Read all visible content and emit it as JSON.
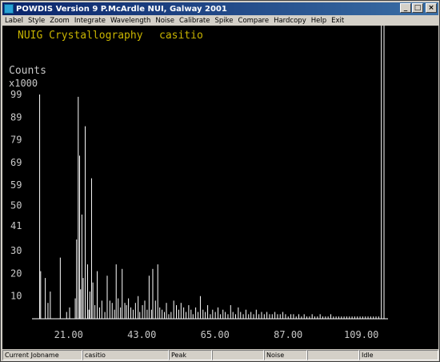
{
  "window": {
    "title": "POWDIS Version 9 P.McArdle NUI, Galway 2001",
    "buttons": {
      "minimize": "_",
      "maximize": "□",
      "close": "×"
    }
  },
  "menu": [
    "Label",
    "Style",
    "Zoom",
    "Integrate",
    "Wavelength",
    "Noise",
    "Calibrate",
    "Spike",
    "Compare",
    "Hardcopy",
    "Help",
    "Exit"
  ],
  "plot": {
    "header_lab": "NUIG Crystallography",
    "header_sample": "casitio",
    "y_label_1": "Counts",
    "y_label_2": "x1000",
    "colors": {
      "background": "#000000",
      "text": "#c8b400",
      "axis": "#ffffff",
      "data": "#ffffff"
    }
  },
  "chart_data": {
    "type": "bar",
    "title": "",
    "xlabel": "",
    "ylabel": "Counts x1000",
    "xlim": [
      10,
      117
    ],
    "ylim": [
      0,
      99
    ],
    "x_ticks": [
      "21.00",
      "43.00",
      "65.00",
      "87.00",
      "109.00"
    ],
    "y_ticks": [
      "10",
      "20",
      "30",
      "41",
      "50",
      "59",
      "69",
      "79",
      "89",
      "99"
    ],
    "x": [
      12.3,
      12.6,
      14.0,
      14.8,
      15.5,
      18.5,
      20.4,
      21.3,
      23.0,
      23.4,
      23.9,
      24.3,
      24.6,
      25.0,
      25.4,
      26.0,
      26.7,
      27.1,
      27.4,
      27.9,
      28.3,
      28.9,
      29.6,
      30.3,
      31.0,
      31.9,
      32.6,
      33.4,
      34.1,
      34.8,
      35.3,
      35.9,
      36.6,
      37.1,
      37.9,
      38.4,
      39.0,
      39.7,
      40.4,
      41.1,
      41.9,
      42.4,
      43.2,
      43.9,
      44.6,
      45.2,
      45.9,
      46.3,
      47.1,
      47.8,
      48.4,
      49.1,
      49.8,
      50.4,
      51.1,
      51.8,
      52.6,
      53.4,
      54.1,
      54.8,
      55.6,
      56.3,
      57.1,
      57.8,
      58.4,
      59.2,
      59.9,
      60.6,
      61.4,
      62.1,
      62.8,
      63.6,
      64.3,
      65.1,
      65.9,
      66.6,
      67.4,
      68.1,
      68.9,
      69.7,
      70.4,
      71.2,
      72.0,
      72.7,
      73.5,
      74.3,
      75.1,
      75.8,
      76.6,
      77.4,
      78.2,
      79.0,
      79.8,
      80.6,
      81.4,
      82.2,
      83.0,
      83.8,
      84.6,
      85.4,
      86.2,
      87.0,
      87.8,
      88.6,
      89.4,
      90.2,
      91.0,
      91.8,
      92.6,
      93.4,
      94.2,
      95.0,
      95.8,
      96.6,
      97.4,
      98.2,
      99.0,
      99.8,
      100.6,
      101.4,
      102.2,
      103.0,
      103.8,
      104.6,
      105.4,
      106.2,
      107.0,
      107.8,
      108.6,
      109.4,
      110.2,
      111.0,
      111.8,
      112.6,
      113.4,
      114.2,
      115.0,
      115.8
    ],
    "values": [
      99,
      21,
      18,
      7,
      12,
      27,
      3,
      5,
      9,
      35,
      98,
      72,
      13,
      46,
      18,
      85,
      24,
      4,
      12,
      62,
      16,
      6,
      21,
      5,
      8,
      3,
      19,
      8,
      7,
      4,
      24,
      9,
      5,
      22,
      7,
      6,
      9,
      5,
      4,
      7,
      10,
      3,
      6,
      8,
      4,
      19,
      4,
      22,
      8,
      24,
      5,
      4,
      3,
      7,
      2,
      3,
      8,
      6,
      4,
      7,
      5,
      3,
      6,
      4,
      2,
      5,
      3,
      10,
      4,
      3,
      6,
      2,
      4,
      3,
      5,
      2,
      4,
      3,
      2,
      6,
      3,
      2,
      5,
      3,
      2,
      4,
      2,
      3,
      2,
      4,
      2,
      3,
      2,
      3,
      2,
      2,
      3,
      2,
      2,
      3,
      2,
      1,
      2,
      2,
      1,
      2,
      1,
      2,
      1,
      1,
      2,
      1,
      1,
      2,
      1,
      1,
      1,
      2,
      1,
      1,
      1,
      1,
      1,
      1,
      1,
      1,
      1,
      1,
      1,
      1,
      1,
      1,
      1,
      1,
      1,
      1
    ]
  },
  "status": {
    "job_label": "Current Jobname",
    "job_value": "casitio",
    "peak_label": "Peak",
    "peak_value": "",
    "noise_label": "Noise",
    "noise_value": "",
    "state": "Idle"
  }
}
